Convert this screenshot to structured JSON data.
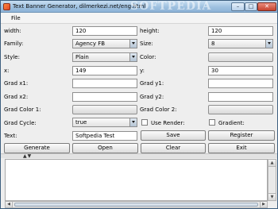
{
  "window": {
    "title": "Text Banner Generator, dilmerkezi.net/eng.html",
    "watermark": "SOFTPEDIA",
    "minimize_glyph": "–",
    "maximize_glyph": "□",
    "close_glyph": "✕"
  },
  "menu": {
    "file": "File"
  },
  "form": {
    "width_label": "width:",
    "width_value": "120",
    "height_label": "height:",
    "height_value": "120",
    "family_label": "Family:",
    "family_value": "Agency FB",
    "size_label": "Size:",
    "size_value": "8",
    "style_label": "Style:",
    "style_value": "Plain",
    "color_label": "Color:",
    "x_label": "x:",
    "x_value": "149",
    "y_label": "y:",
    "y_value": "30",
    "grad_x1_label": "Grad x1:",
    "grad_x1_value": "",
    "grad_y1_label": "Grad y1:",
    "grad_y1_value": "",
    "grad_x2_label": "Grad x2:",
    "grad_x2_value": "",
    "grad_y2_label": "Grad y2:",
    "grad_y2_value": "",
    "grad_color1_label": "Grad Color 1:",
    "grad_color2_label": "Grad Color 2:",
    "grad_cycle_label": "Grad Cycle:",
    "grad_cycle_value": "true",
    "use_render_label": "Use Render:",
    "gradient_label": "Gradient:",
    "text_label": "Text:",
    "text_value": "Softpedia Test"
  },
  "buttons": {
    "save": "Save",
    "register": "Register",
    "generate": "Generate",
    "open": "Open",
    "clear": "Clear",
    "exit": "Exit"
  },
  "scroll": {
    "up": "▲",
    "down": "▼",
    "left": "◀",
    "right": "▶",
    "split_arrows": "▲▼"
  }
}
